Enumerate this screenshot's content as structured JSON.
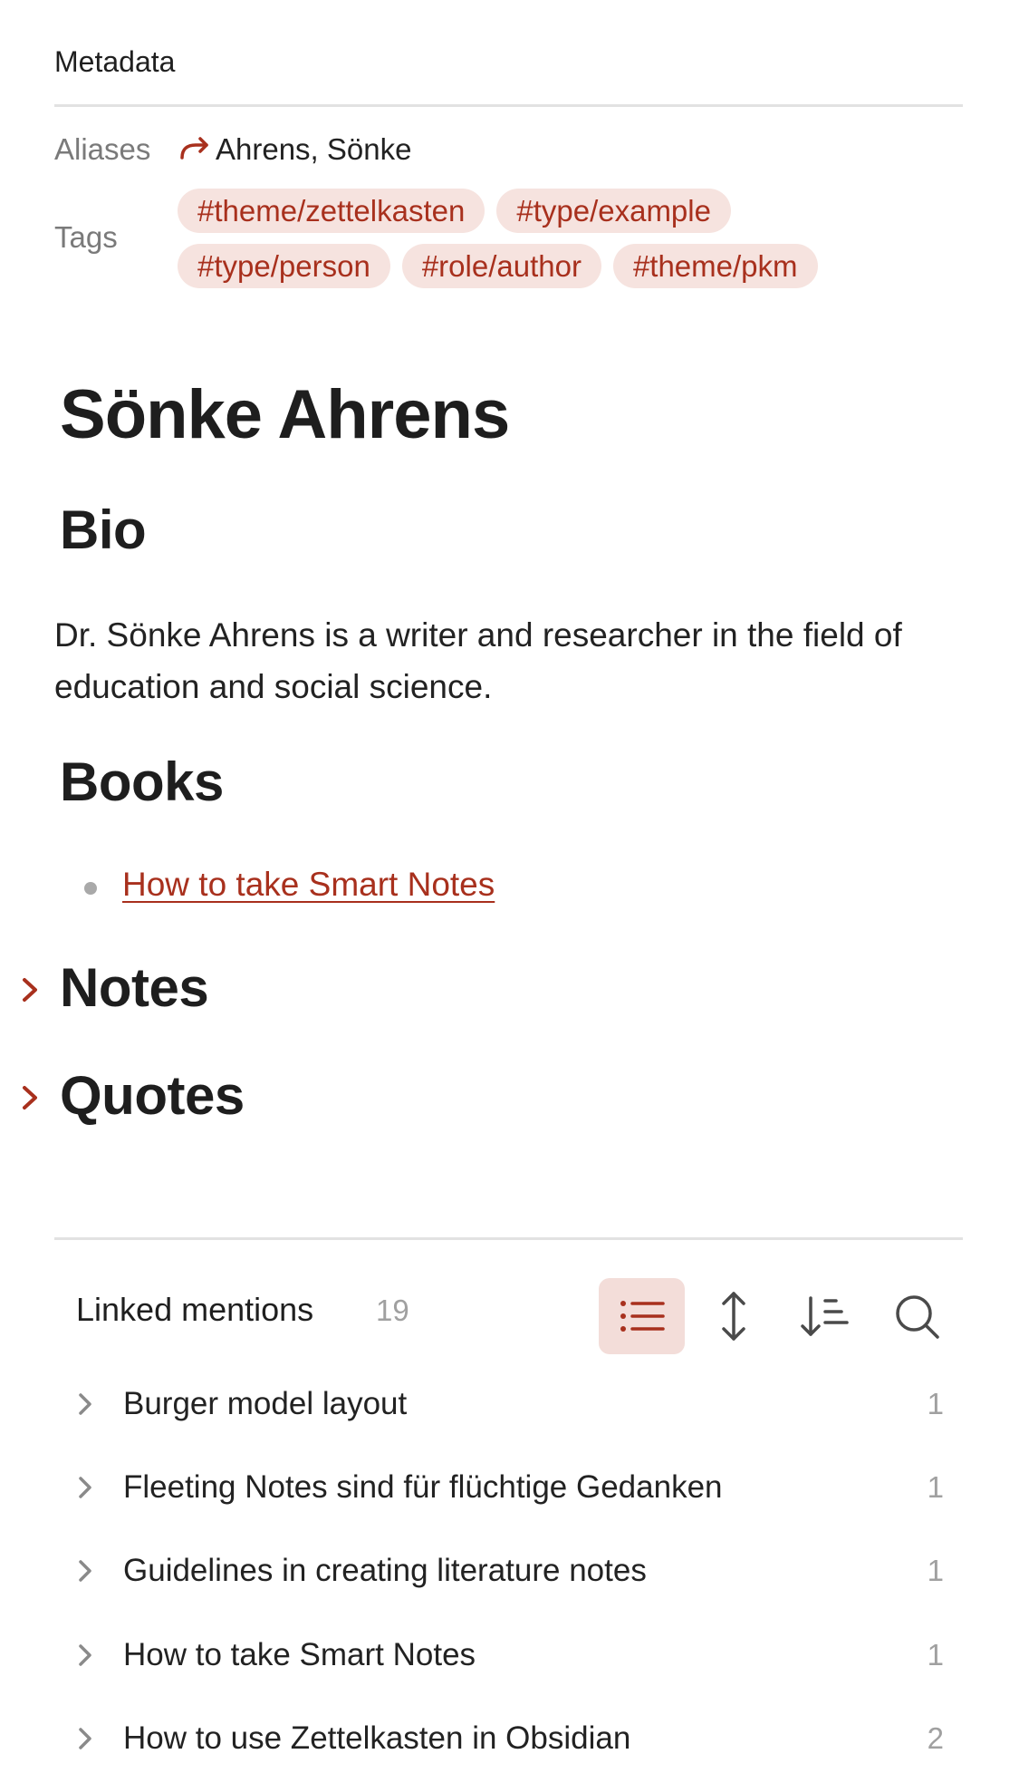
{
  "metadata": {
    "title": "Metadata",
    "aliases_label": "Aliases",
    "aliases_value": "Ahrens, Sönke",
    "tags_label": "Tags",
    "tags": [
      "#theme/zettelkasten",
      "#type/example",
      "#type/person",
      "#role/author",
      "#theme/pkm"
    ]
  },
  "note": {
    "title": "Sönke Ahrens",
    "bio_heading": "Bio",
    "bio_text": "Dr. Sönke Ahrens is a writer and researcher in the field of education and social science.",
    "books_heading": "Books",
    "books": [
      "How to take Smart Notes"
    ],
    "notes_heading": "Notes",
    "quotes_heading": "Quotes"
  },
  "linked_mentions": {
    "title": "Linked mentions",
    "count": "19",
    "toolbar": [
      "list-icon",
      "expand-collapse-icon",
      "sort-icon",
      "search-icon"
    ],
    "items": [
      {
        "label": "Burger model layout",
        "count": "1"
      },
      {
        "label": "Fleeting Notes sind für flüchtige Gedanken",
        "count": "1"
      },
      {
        "label": "Guidelines in creating literature notes",
        "count": "1"
      },
      {
        "label": "How to take Smart Notes",
        "count": "1"
      },
      {
        "label": "How to use Zettelkasten in Obsidian",
        "count": "2"
      }
    ]
  },
  "colors": {
    "accent": "#a8301d",
    "tag_background": "#f6e3df",
    "muted_text": "#a0a0a0"
  }
}
